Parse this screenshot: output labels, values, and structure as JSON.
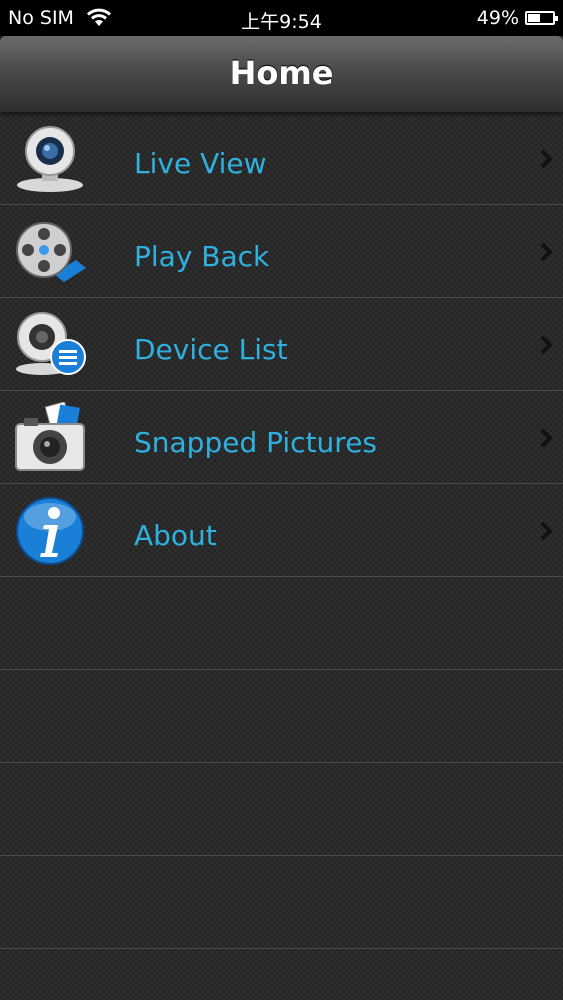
{
  "status_bar": {
    "carrier": "No SIM",
    "time": "上午9:54",
    "battery_percent": "49%",
    "battery_level": 0.49
  },
  "nav": {
    "title": "Home"
  },
  "menu": {
    "items": [
      {
        "label": "Live View",
        "icon": "webcam-icon"
      },
      {
        "label": "Play Back",
        "icon": "film-reel-icon"
      },
      {
        "label": "Device List",
        "icon": "device-list-icon"
      },
      {
        "label": "Snapped Pictures",
        "icon": "camera-photos-icon"
      },
      {
        "label": "About",
        "icon": "info-icon"
      }
    ]
  },
  "colors": {
    "label": "#2fb0df",
    "accent_blue": "#1a7fd6"
  }
}
